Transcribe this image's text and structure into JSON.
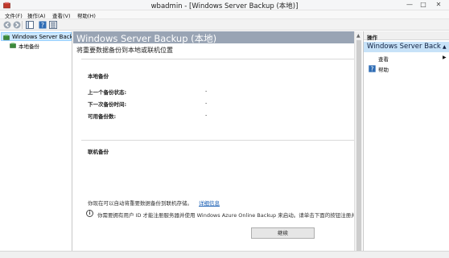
{
  "window": {
    "title": "wbadmin - [Windows Server Backup (本地)]",
    "minimize": "—",
    "maximize": "□",
    "close": "✕"
  },
  "menu": {
    "items": [
      "文件(F)",
      "操作(A)",
      "查看(V)",
      "帮助(H)"
    ]
  },
  "toolbar": {
    "buttons": [
      "back-arrow-icon",
      "forward-arrow-icon",
      "show-tree-icon",
      "help-icon",
      "properties-icon"
    ]
  },
  "tree": {
    "root": "Windows Server Backup",
    "child": "本地备份"
  },
  "main": {
    "title": "Windows Server Backup (本地)",
    "subtitle": "将重要数据备份到本地或联机位置",
    "local_backup": {
      "heading": "本地备份",
      "rows": [
        {
          "label": "上一个备份状态:",
          "value": "-"
        },
        {
          "label": "下一次备份时间:",
          "value": "-"
        },
        {
          "label": "可用备份数:",
          "value": "-"
        }
      ]
    },
    "online_backup": {
      "heading": "联机备份",
      "description": "你现在可以自动将重要数据备份到联机存储。",
      "link": "详细信息",
      "info": "你需要拥有用户 ID 才能注册服务器并使用 Windows Azure Online Backup 来启动。请单击下面的按钮注册并",
      "button": "继续"
    }
  },
  "actions": {
    "heading": "操作",
    "group": "Windows Server Backup",
    "items": [
      {
        "label": "查看",
        "arrow": "▶"
      },
      {
        "label": "帮助",
        "arrow": ""
      }
    ],
    "group_arrow": "▲"
  },
  "colors": {
    "header_bar": "#99a4b4",
    "tree_selected": "#cce8ff",
    "actions_group": "#c7e2f8",
    "link": "#1a5fb4"
  }
}
